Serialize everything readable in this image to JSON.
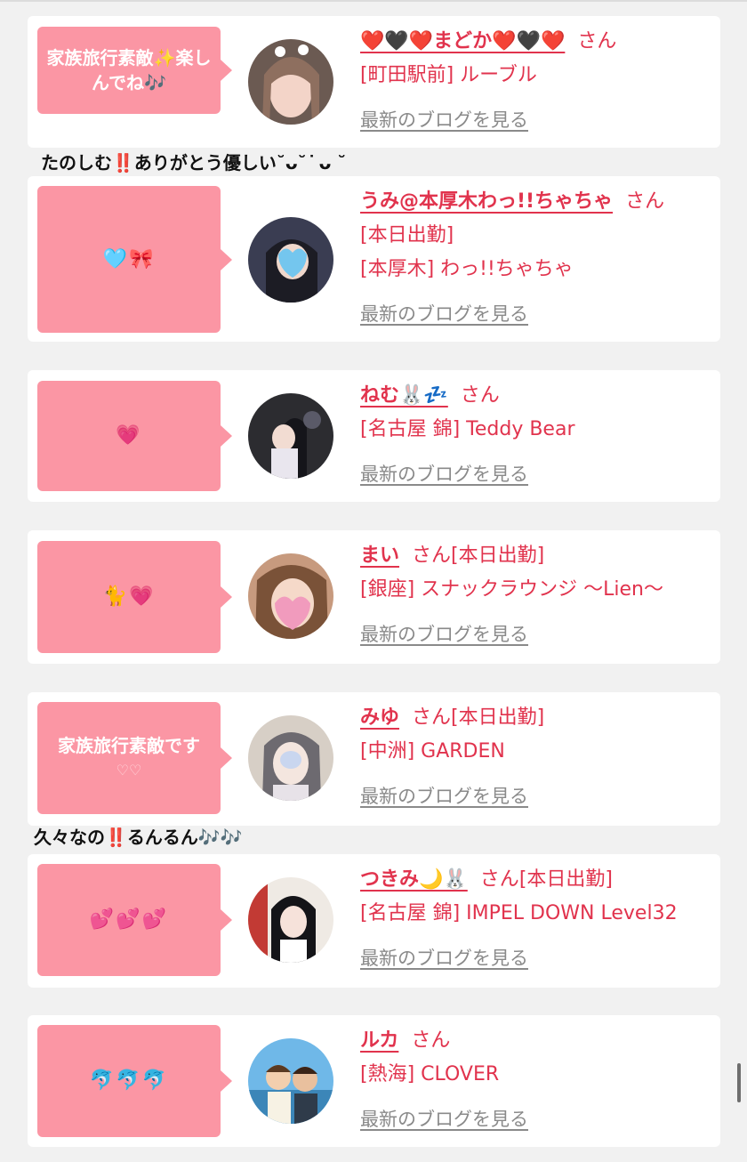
{
  "blog_link_label": "最新のブログを見る",
  "san_suffix": "さん",
  "entries": [
    {
      "bubble": "家族旅行素敵✨楽しんでね🎶",
      "name": "❤️🖤❤️まどか❤️🖤❤️",
      "after_san": "",
      "lines": [
        "[町田駅前] ルーブル"
      ],
      "avatar_icon": "avatar-photo"
    },
    {
      "bubble": "🩵🎀",
      "name": "うみ@本厚木わっ!!ちゃちゃ",
      "after_san": "",
      "lines": [
        "[本日出勤]",
        "[本厚木] わっ!!ちゃちゃ"
      ],
      "avatar_icon": "avatar-photo"
    },
    {
      "bubble": "💗",
      "name": "ねむ🐰💤",
      "after_san": "",
      "lines": [
        "[名古屋 錦] Teddy Bear"
      ],
      "avatar_icon": "avatar-photo"
    },
    {
      "bubble": "🐈💗",
      "name": "まい",
      "after_san": "[本日出勤]",
      "lines": [
        "[銀座] スナックラウンジ 〜Lien〜"
      ],
      "avatar_icon": "avatar-photo"
    },
    {
      "bubble": "家族旅行素敵です",
      "bubble_sub": "♡♡",
      "name": "みゆ",
      "after_san": "[本日出勤]",
      "lines": [
        "[中洲] GARDEN"
      ],
      "avatar_icon": "avatar-photo"
    },
    {
      "bubble": "💕💕💕",
      "name": "つきみ🌙🐰",
      "after_san": "[本日出勤]",
      "lines": [
        "[名古屋 錦] IMPEL DOWN Level32"
      ],
      "avatar_icon": "avatar-photo"
    },
    {
      "bubble": "🐬🐬🐬",
      "name": "ルカ",
      "after_san": "",
      "lines": [
        "[熱海] CLOVER"
      ],
      "avatar_icon": "avatar-photo"
    }
  ],
  "comments": [
    "たのしむ‼️ありがとう優しい˘ᴗ˘ ͘ ᴗ ˘",
    "久々なの‼️るんるん🎶🎶"
  ],
  "colors": {
    "accent": "#e1334d",
    "bubble": "#fb96a4",
    "card": "#ffffff",
    "page": "#f1f1f1",
    "link_gray": "#8a8a8a"
  }
}
